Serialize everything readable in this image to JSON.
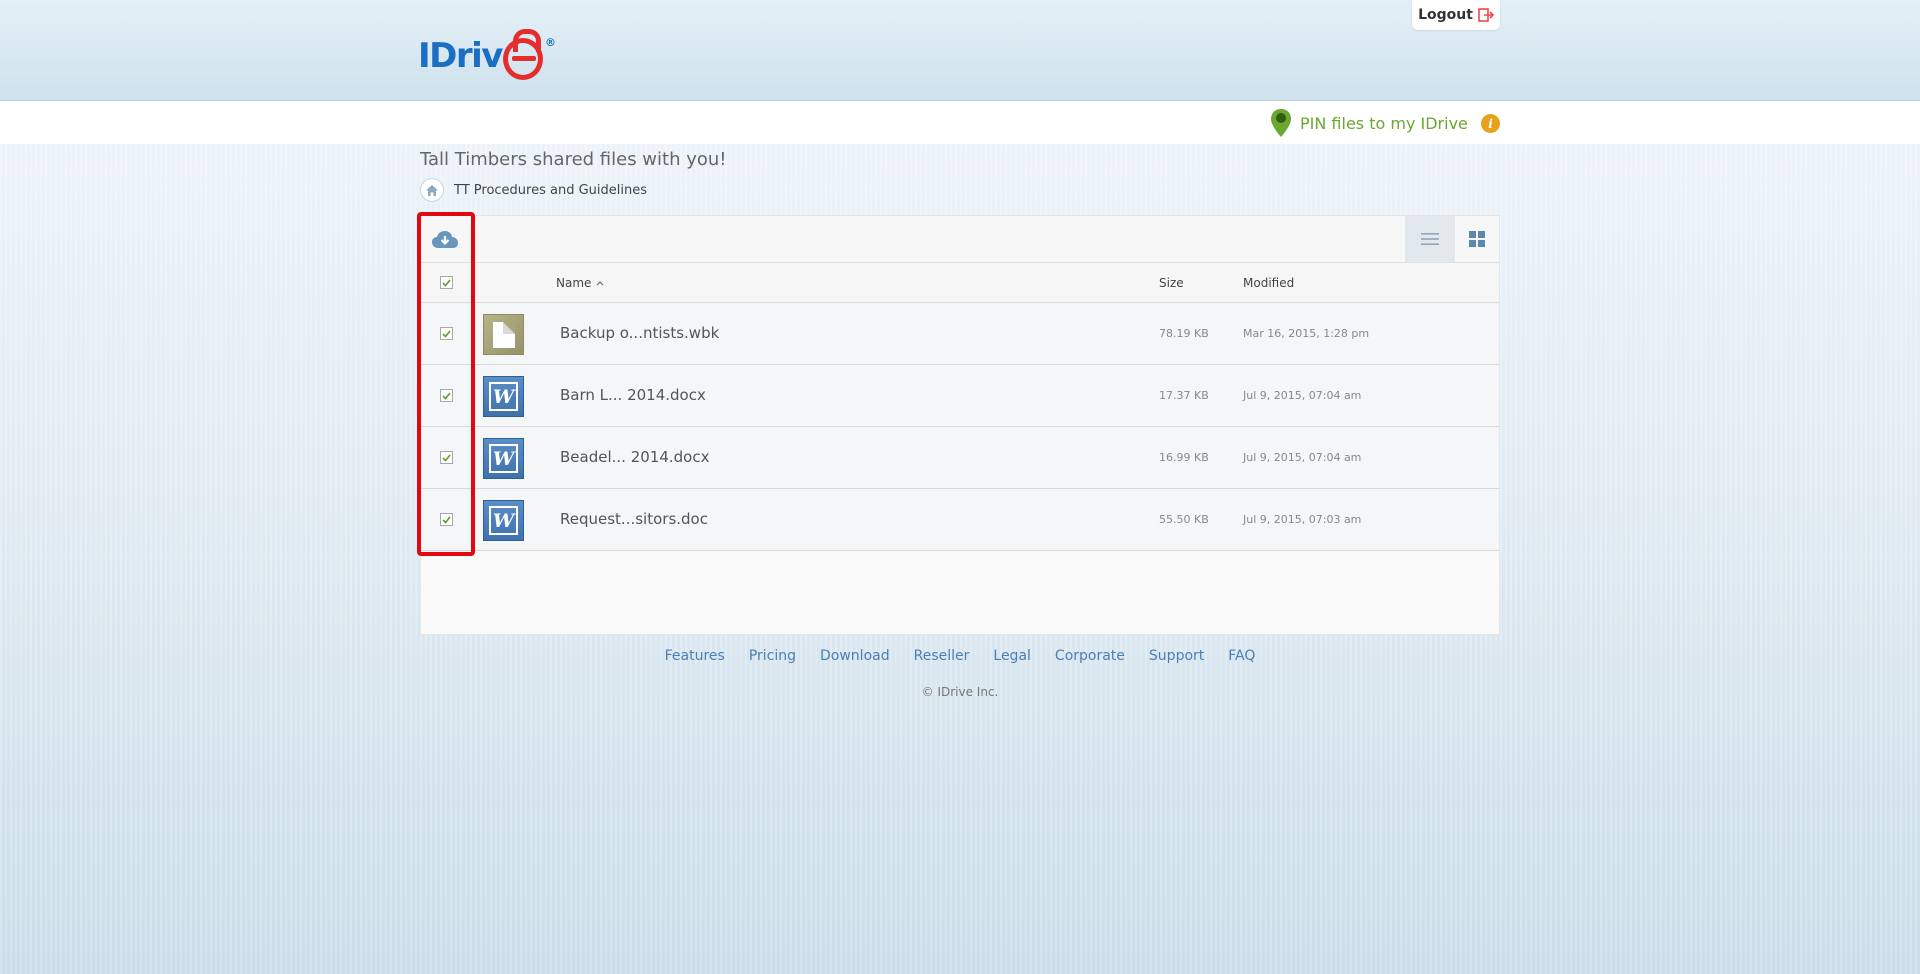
{
  "header": {
    "logo_text": "IDriv",
    "logo_reg": "®",
    "logout_label": "Logout"
  },
  "pinbar": {
    "pin_label": "PIN files to my IDrive",
    "info_glyph": "i"
  },
  "share": {
    "title": "Tall Timbers shared files with you!",
    "breadcrumb": "TT Procedures and Guidelines"
  },
  "table": {
    "headers": {
      "name": "Name",
      "size": "Size",
      "modified": "Modified"
    },
    "sort_glyph": "^",
    "rows": [
      {
        "name": "Backup o...ntists.wbk",
        "size": "78.19 KB",
        "modified": "Mar 16, 2015, 1:28 pm",
        "icon": "generic-file-icon",
        "checked": true
      },
      {
        "name": "Barn L... 2014.docx",
        "size": "17.37 KB",
        "modified": "Jul 9, 2015, 07:04 am",
        "icon": "word-file-icon",
        "checked": true
      },
      {
        "name": "Beadel... 2014.docx",
        "size": "16.99 KB",
        "modified": "Jul 9, 2015, 07:04 am",
        "icon": "word-file-icon",
        "checked": true
      },
      {
        "name": "Request...sitors.doc",
        "size": "55.50 KB",
        "modified": "Jul 9, 2015, 07:03 am",
        "icon": "word-file-icon",
        "checked": true
      }
    ],
    "word_glyph": "W"
  },
  "footer": {
    "links": [
      "Features",
      "Pricing",
      "Download",
      "Reseller",
      "Legal",
      "Corporate",
      "Support",
      "FAQ"
    ],
    "copyright": "© IDrive Inc."
  },
  "colors": {
    "brand_blue": "#1a6fc4",
    "brand_red": "#e52d2d",
    "pin_green": "#6aa832",
    "highlight_red": "#e3080f",
    "link_blue": "#4a7fb5"
  }
}
